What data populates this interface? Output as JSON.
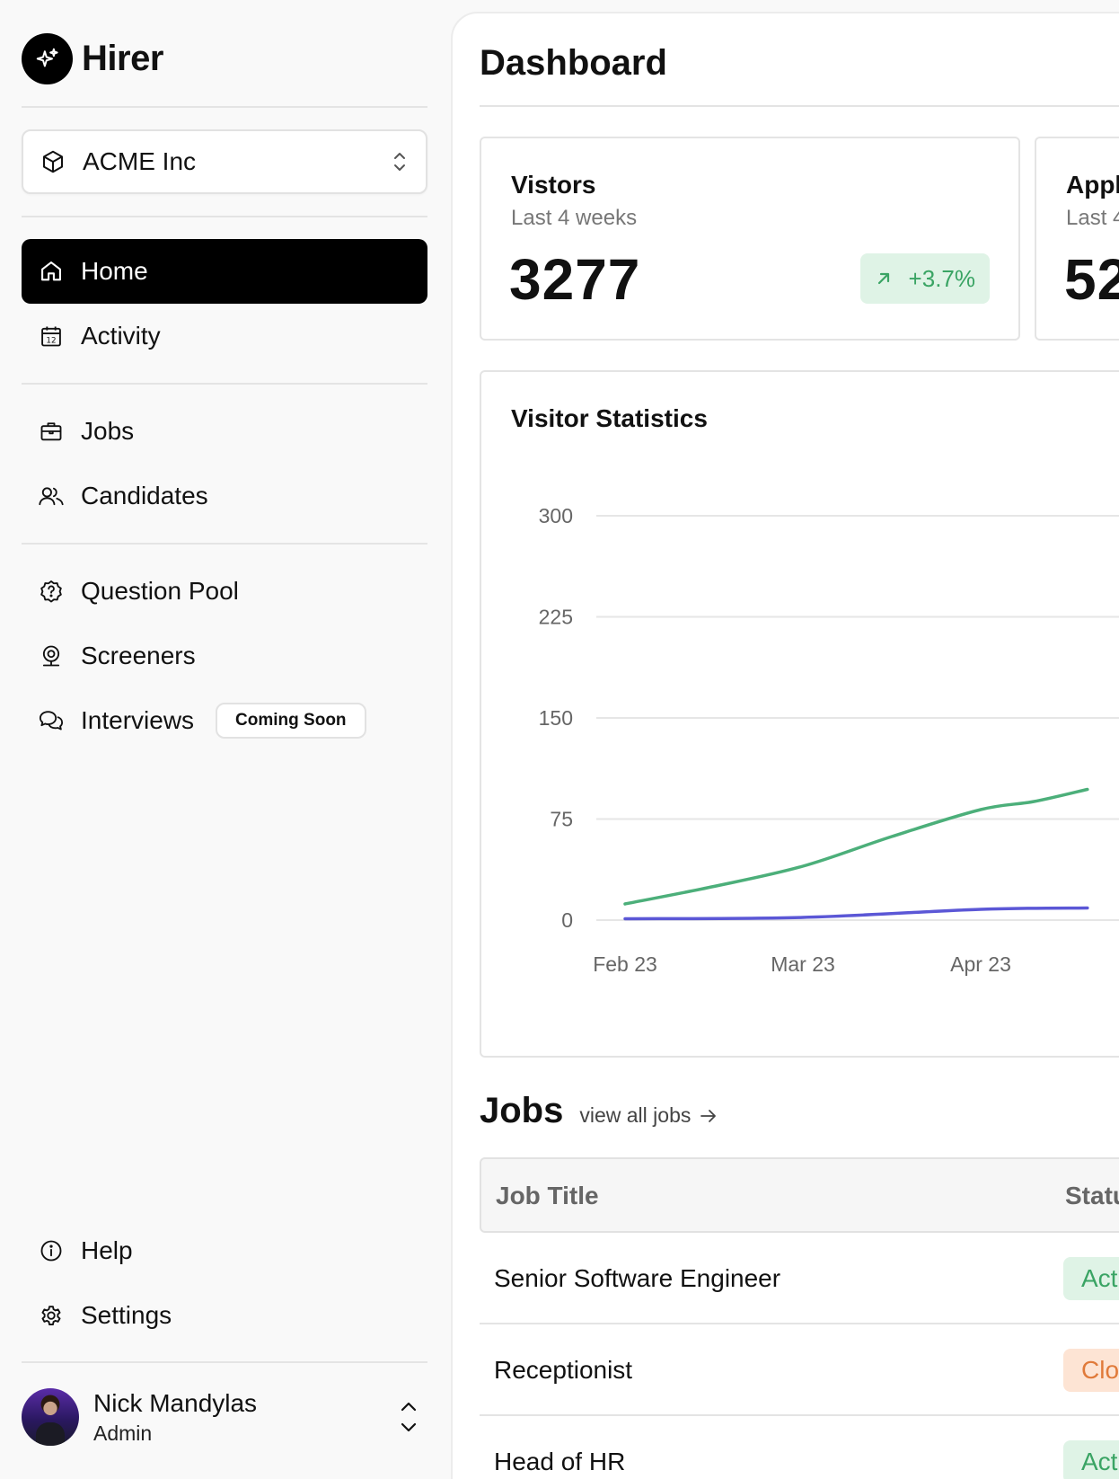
{
  "brand": {
    "name": "Hirer"
  },
  "org_select": {
    "label": "ACME Inc"
  },
  "nav": {
    "primary": [
      {
        "label": "Home",
        "icon": "home-icon",
        "active": true
      },
      {
        "label": "Activity",
        "icon": "calendar-icon"
      }
    ],
    "secondary": [
      {
        "label": "Jobs",
        "icon": "briefcase-icon"
      },
      {
        "label": "Candidates",
        "icon": "users-icon"
      }
    ],
    "tertiary": [
      {
        "label": "Question Pool",
        "icon": "question-badge-icon"
      },
      {
        "label": "Screeners",
        "icon": "webcam-icon"
      },
      {
        "label": "Interviews",
        "icon": "chat-bubbles-icon",
        "badge": "Coming Soon"
      }
    ],
    "bottom": [
      {
        "label": "Help",
        "icon": "info-icon"
      },
      {
        "label": "Settings",
        "icon": "gear-icon"
      }
    ]
  },
  "user": {
    "name": "Nick Mandylas",
    "role": "Admin"
  },
  "page": {
    "title": "Dashboard"
  },
  "stats": [
    {
      "title": "Vistors",
      "subtitle": "Last 4 weeks",
      "value": "3277",
      "change": "+3.7%"
    },
    {
      "title": "Appl",
      "subtitle": "Last 4",
      "value": "52"
    }
  ],
  "chart_card": {
    "title": "Visitor Statistics"
  },
  "chart_data": {
    "type": "line",
    "title": "Visitor Statistics",
    "x": [
      "Feb 23",
      "Mar 23",
      "Apr 23"
    ],
    "ylim": [
      0,
      300
    ],
    "yticks": [
      0,
      75,
      150,
      225,
      300
    ],
    "grid": true,
    "series": [
      {
        "color": "#4caf7a",
        "points": [
          [
            0,
            12
          ],
          [
            0.5,
            25
          ],
          [
            1,
            40
          ],
          [
            1.5,
            62
          ],
          [
            2,
            82
          ],
          [
            2.3,
            88
          ],
          [
            2.6,
            97
          ]
        ]
      },
      {
        "color": "#5b57d6",
        "points": [
          [
            0,
            1
          ],
          [
            1,
            2
          ],
          [
            2,
            8
          ],
          [
            2.6,
            9
          ]
        ]
      }
    ]
  },
  "jobs": {
    "title": "Jobs",
    "link": "view all jobs",
    "columns": [
      "Job Title",
      "Statu"
    ],
    "rows": [
      {
        "title": "Senior Software Engineer",
        "status": "Act",
        "status_color": "#3aa464",
        "status_bg": "#dff3e6"
      },
      {
        "title": "Receptionist",
        "status": "Clo",
        "status_color": "#e07a3a",
        "status_bg": "#fde4d4"
      },
      {
        "title": "Head of HR",
        "status": "Act",
        "status_color": "#3aa464",
        "status_bg": "#dff3e6"
      }
    ]
  }
}
